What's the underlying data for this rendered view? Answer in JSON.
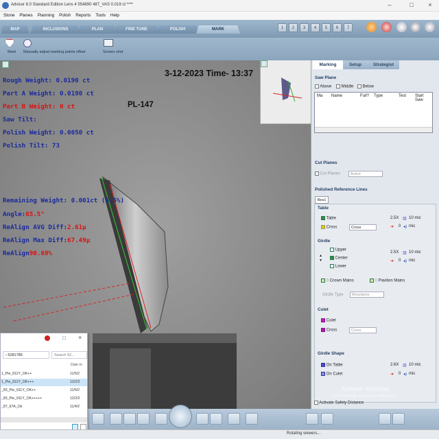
{
  "titlebar": {
    "title": "Advisor 8.0 Standard Edition Lens 4   554890 487_VAS   0.019 ct  ****",
    "minimize": "–",
    "maximize": "□",
    "close": "×"
  },
  "menu": [
    "Stone",
    "Planes",
    "Planning",
    "Polish",
    "Reports",
    "Tools",
    "Help"
  ],
  "tabs": [
    "MAP",
    "INCLUSIONS",
    "PLAN",
    "FINE TUNE",
    "POLISH",
    "MARK"
  ],
  "active_tab": "MARK",
  "step_numbers": [
    "1",
    "2",
    "3",
    "4",
    "5",
    "6",
    "7"
  ],
  "toolbar": {
    "mark_label": "Mark",
    "adjust_label": "Manually adjust marking points offset",
    "screenshot_label": "Screen shot"
  },
  "viewer": {
    "datetime": "3-12-2023 Time- 13:37",
    "stone_id": "PL-147",
    "lines": [
      {
        "text": "Rough Weight: 0.0190 ct",
        "color": "blue"
      },
      {
        "text": "Part A Weight: 0.0190 ct",
        "color": "blue"
      },
      {
        "text": "Part B Weight: 0 ct",
        "color": "red"
      },
      {
        "text": "Saw Tilt:",
        "color": "blue"
      },
      {
        "text": "Polish Weight: 0.0050 ct",
        "color": "blue"
      },
      {
        "text": "Polish Tilt: 73",
        "color": "blue"
      }
    ],
    "remaining": {
      "label": "Remaining Weight: 0.001ct",
      "pct": "(6.5%)"
    },
    "angle": {
      "label": "Angle:",
      "value": "65.5°"
    },
    "avg_diff": {
      "label": "ReAlign AVG Diff:",
      "value": "2.61μ"
    },
    "max_diff": {
      "label": "ReAlign Max Diff:",
      "value": "67.49μ"
    },
    "realign": {
      "label": "ReAlign",
      "value": "90.69%"
    }
  },
  "panel": {
    "tabs": [
      "Marking",
      "Setup",
      "Strategist"
    ],
    "saw_plane": {
      "title": "Saw Plane",
      "checks": [
        "Above",
        "Middle",
        "Below"
      ],
      "columns": [
        "Ma",
        "Name",
        "Full?",
        "Type",
        "Test",
        "Start Saw"
      ]
    },
    "cut_planes": {
      "title": "Cut Planes",
      "checkbox": "Cut Planes",
      "select": "Active"
    },
    "polished_ref": {
      "title": "Polished Reference Lines",
      "tab": "Res1",
      "table": {
        "title": "Table",
        "table_label": "Table",
        "cross_label": "Cross",
        "cross_select": "Cross",
        "size": "2.5X",
        "mic": "10 mic",
        "offset": "0",
        "offset_unit": "mic"
      },
      "girdle": {
        "title": "Girdle",
        "upper": "Upper",
        "center": "Center",
        "lower": "Lower",
        "size": "2.5X",
        "mic": "10 mic",
        "offset": "0",
        "offset_unit": "mic",
        "crown_value": "0",
        "crown_label": "Crown Mains",
        "pav_value": "0",
        "pav_label": "Pavilion Mains",
        "type_label": "Girdle Type",
        "type_select": "Mountains"
      },
      "culet": {
        "title": "Culet",
        "culet_label": "Culet",
        "cross_label": "Cross",
        "cross_select": "Cross"
      },
      "girdle_shape": {
        "title": "Girdle Shape",
        "on_table": "On Table",
        "on_culet": "On Culet",
        "size": "2.6X",
        "mic": "10 mic",
        "offset": "0",
        "offset_unit": "mic"
      }
    },
    "safety": "Activate Safety Distance"
  },
  "explorer": {
    "path": "5281786",
    "search": "Search 52...",
    "col_date": "Date m",
    "rows": [
      {
        "name": "1_Pie_911Y_OK++",
        "date": "11/5/2"
      },
      {
        "name": "1_Pie_911Y_OK+++",
        "date": "12/2/2"
      },
      {
        "name": "_83_Pie_911Y_OK++",
        "date": "11/5/2"
      },
      {
        "name": "_83_Pie_911Y_OK+++++",
        "date": "12/2/2"
      },
      {
        "name": "_87_97A_Ok",
        "date": "11/4/2"
      }
    ]
  },
  "watermark": {
    "line1": "Activate Windows",
    "line2": "Go to Settings to activate Windows."
  },
  "status": "Rotating viewers..."
}
